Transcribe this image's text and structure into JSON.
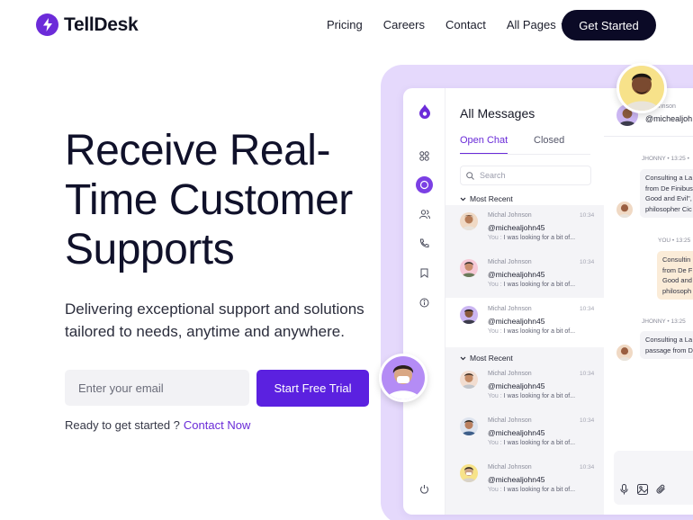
{
  "brand": {
    "name": "TellDesk",
    "accent": "#5b21e0"
  },
  "nav": {
    "links": [
      "Pricing",
      "Careers",
      "Contact",
      "All Pages"
    ],
    "cta": "Get Started"
  },
  "hero": {
    "title_line1": "Receive Real-",
    "title_line2": "Time Customer",
    "title_line3": "Supports",
    "subtitle": "Delivering exceptional support and solutions tailored to needs, anytime and anywhere.",
    "email_placeholder": "Enter your email",
    "cta": "Start Free Trial",
    "ready_text": "Ready to get started ?",
    "ready_link": "Contact Now"
  },
  "app": {
    "title": "All Messages",
    "tabs": [
      "Open Chat",
      "Closed"
    ],
    "search_placeholder": "Search",
    "groups": [
      {
        "title": "Most Recent",
        "items": [
          {
            "name": "Michal Johnson",
            "time": "10:34",
            "handle": "@michealjohn45",
            "you": "You :",
            "preview": "I was looking for a bit of...",
            "avatar": "man-1"
          },
          {
            "name": "Michal Johnson",
            "time": "10:34",
            "handle": "@michealjohn45",
            "you": "You :",
            "preview": "I was looking for a bit of...",
            "avatar": "man-2"
          },
          {
            "name": "Michal Johnson",
            "time": "10:34",
            "handle": "@michealjohn45",
            "you": "You :",
            "preview": "I was looking for a bit of...",
            "avatar": "man-3"
          }
        ]
      },
      {
        "title": "Most Recent",
        "items": [
          {
            "name": "Michal Johnson",
            "time": "10:34",
            "handle": "@michealjohn45",
            "you": "You :",
            "preview": "I was looking for a bit of...",
            "avatar": "man-4"
          },
          {
            "name": "Michal Johnson",
            "time": "10:34",
            "handle": "@michealjohn45",
            "you": "You :",
            "preview": "I was looking for a bit of...",
            "avatar": "man-5"
          },
          {
            "name": "Michal Johnson",
            "time": "10:34",
            "handle": "@michealjohn45",
            "you": "You :",
            "preview": "I was looking for a bit of...",
            "avatar": "man-6"
          }
        ]
      }
    ],
    "chat": {
      "header_small": "al Johnson",
      "header_handle": "@michealjoh",
      "messages": [
        {
          "meta": "JHONNY  •  13:25  •",
          "lines": [
            "Consulting a La",
            "from De Finibus",
            "Good and Evil\",",
            "philosopher Cic"
          ],
          "side": "in"
        },
        {
          "meta": "YOU  •  13:25",
          "lines": [
            "Consultin",
            "from De F",
            "Good and",
            "philosoph"
          ],
          "side": "out"
        },
        {
          "meta": "JHONNY  •  13:25",
          "lines": [
            "Consulting a La",
            "passage from D"
          ],
          "side": "in"
        }
      ]
    }
  }
}
